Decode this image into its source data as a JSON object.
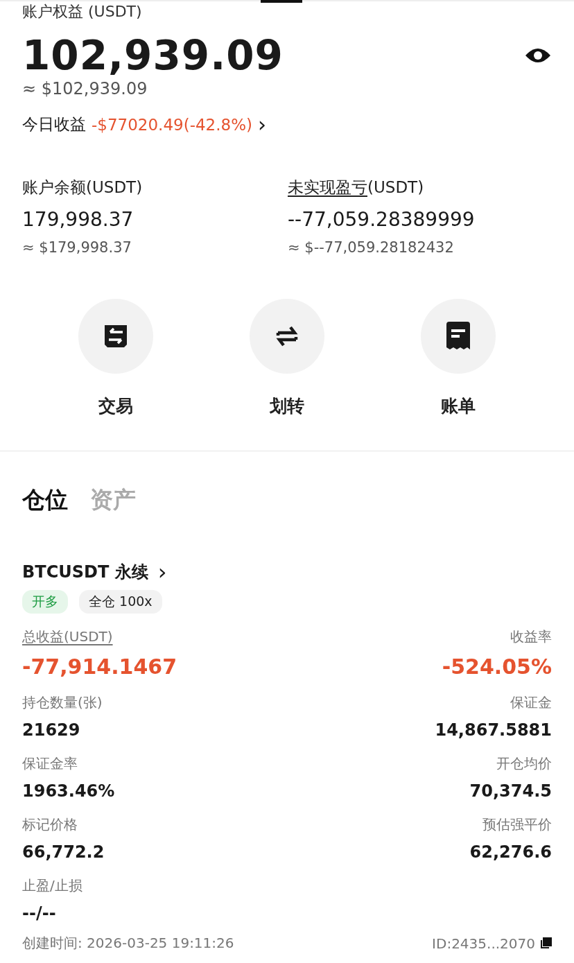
{
  "header": {
    "title": "账户权益 (USDT)",
    "equity": "102,939.09",
    "equity_usd": "≈ $102,939.09",
    "today_label": "今日收益",
    "today_value": "-$77020.49(-42.8%)",
    "chevron": "›"
  },
  "balances": [
    {
      "label": "账户余额",
      "unit": "(USDT)",
      "underlined": false,
      "value": "179,998.37",
      "usd": "≈ $179,998.37"
    },
    {
      "label": "未实现盈亏",
      "unit": "(USDT)",
      "underlined": true,
      "value": "--77,059.28389999",
      "usd": "≈ $--77,059.28182432"
    }
  ],
  "actions": [
    {
      "label": "交易",
      "kind": "trade"
    },
    {
      "label": "划转",
      "kind": "transfer"
    },
    {
      "label": "账单",
      "kind": "bill"
    }
  ],
  "tabs": [
    {
      "label": "仓位",
      "selected": true
    },
    {
      "label": "资产",
      "selected": false
    }
  ],
  "position": {
    "symbol": "BTCUSDT 永续",
    "chevron": "›",
    "tags": [
      {
        "label": "开多",
        "kind": "long"
      },
      {
        "label": "全仓 100x",
        "kind": "mode"
      }
    ],
    "fields": [
      {
        "label": "总收益(USDT)",
        "underlined": true,
        "value": "-77,914.1467",
        "loss": true
      },
      {
        "label": "收益率",
        "underlined": false,
        "value": "-524.05%",
        "loss": true
      },
      {
        "label": "持仓数量(张)",
        "underlined": false,
        "value": "21629",
        "loss": false
      },
      {
        "label": "保证金",
        "underlined": false,
        "value": "14,867.5881",
        "loss": false
      },
      {
        "label": "保证金率",
        "underlined": false,
        "value": "1963.46%",
        "loss": false
      },
      {
        "label": "开仓均价",
        "underlined": false,
        "value": "70,374.5",
        "loss": false
      },
      {
        "label": "标记价格",
        "underlined": false,
        "value": "66,772.2",
        "loss": false
      },
      {
        "label": "预估强平价",
        "underlined": false,
        "value": "62,276.6",
        "loss": false
      },
      {
        "label": "止盈/止损",
        "underlined": false,
        "value": "--/--",
        "loss": false
      }
    ],
    "created": "创建时间: 2026-03-25 19:11:26",
    "id": "ID:2435...2070"
  }
}
